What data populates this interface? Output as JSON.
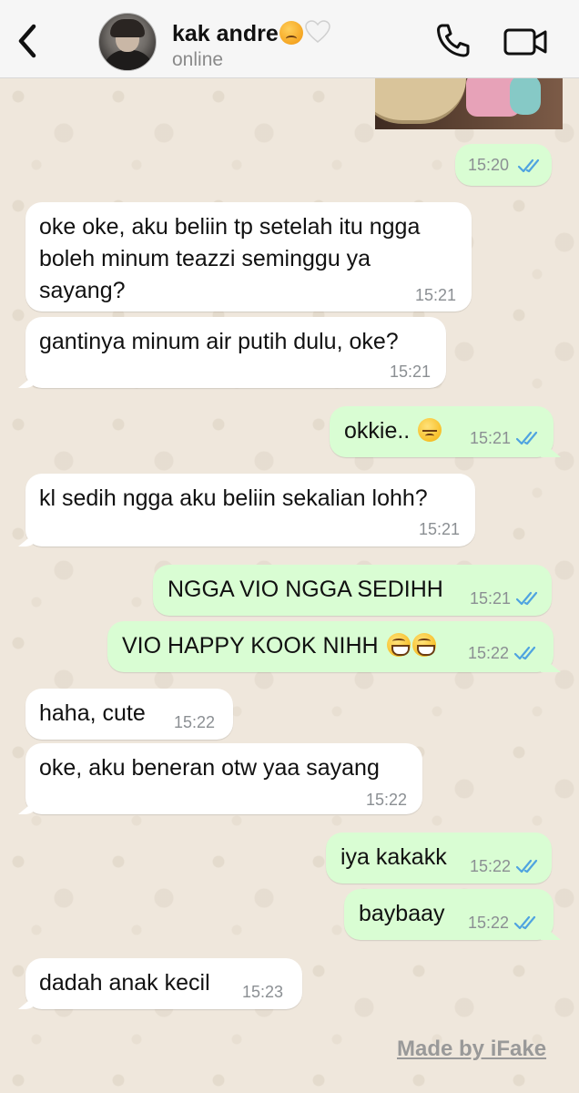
{
  "header": {
    "back_icon": "chevron-left-icon",
    "contact_name": "kak andre",
    "contact_status": "online",
    "call_icon": "phone-icon",
    "video_icon": "video-camera-icon"
  },
  "messages": [
    {
      "id": 0,
      "direction": "out",
      "text": "",
      "time": "15:20",
      "read": true
    },
    {
      "id": 1,
      "direction": "in",
      "lines": [
        "oke oke, aku beliin tp setelah itu ngga",
        "boleh minum teazzi seminggu ya",
        "sayang?"
      ],
      "time": "15:21"
    },
    {
      "id": 2,
      "direction": "in",
      "text": "gantinya minum air putih dulu, oke?",
      "time": "15:21"
    },
    {
      "id": 3,
      "direction": "out",
      "text": "okkie..",
      "emoji": "pensive-face",
      "time": "15:21",
      "read": true
    },
    {
      "id": 4,
      "direction": "in",
      "text": "kl sedih ngga aku beliin sekalian lohh?",
      "time": "15:21"
    },
    {
      "id": 5,
      "direction": "out",
      "text": "NGGA VIO NGGA SEDIHH",
      "time": "15:21",
      "read": true
    },
    {
      "id": 6,
      "direction": "out",
      "text": "VIO HAPPY KOOK NIHH",
      "emoji": "grinning-face x2",
      "time": "15:22",
      "read": true
    },
    {
      "id": 7,
      "direction": "in",
      "text": "haha, cute",
      "time": "15:22"
    },
    {
      "id": 8,
      "direction": "in",
      "text": "oke, aku beneran otw yaa sayang",
      "time": "15:22"
    },
    {
      "id": 9,
      "direction": "out",
      "text": "iya kakakk",
      "time": "15:22",
      "read": true
    },
    {
      "id": 10,
      "direction": "out",
      "text": "baybaay",
      "time": "15:22",
      "read": true
    },
    {
      "id": 11,
      "direction": "in",
      "text": "dadah anak kecil",
      "time": "15:23"
    }
  ],
  "watermark": "Made by iFake",
  "colors": {
    "incoming_bubble": "#ffffff",
    "outgoing_bubble": "#d9fdd3",
    "read_ticks": "#4fa3e0",
    "wallpaper": "#efe7dc",
    "header_bg": "#f6f6f6"
  }
}
